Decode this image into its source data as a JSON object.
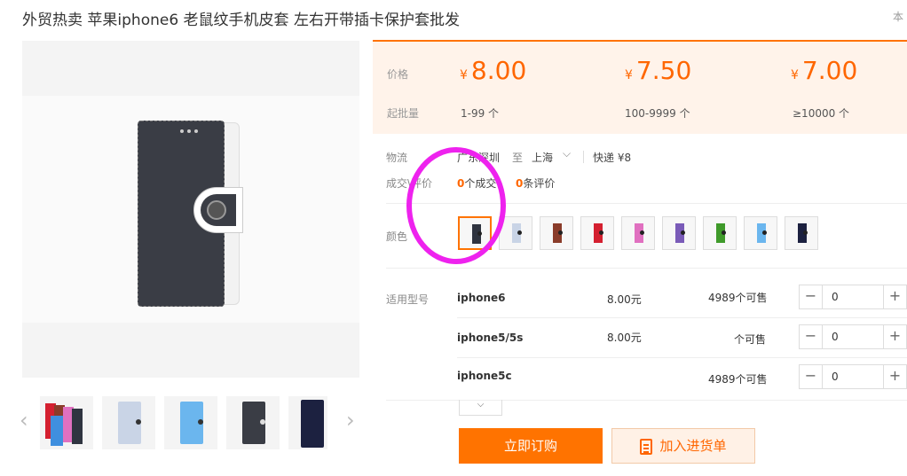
{
  "title": "外贸热卖 苹果iphone6 老鼠纹手机皮套 左右开带插卡保护套批发",
  "title_right": "本",
  "gallery": {
    "prev_icon": "‹",
    "next_icon": "›"
  },
  "price_section": {
    "price_label": "价格",
    "moq_label": "起批量",
    "currency": "¥",
    "tiers": [
      {
        "price": "8.00",
        "range": "1-99 个"
      },
      {
        "price": "7.50",
        "range": "100-9999 个"
      },
      {
        "price": "7.00",
        "range": "≥10000 个"
      }
    ]
  },
  "logistics": {
    "label": "物流",
    "from": "广东深圳",
    "to_word": "至",
    "to": "上海",
    "shipping": "快递 ¥8"
  },
  "deals": {
    "label": "成交\\评价",
    "deal_count": "0",
    "deal_suffix": "个成交",
    "review_count": "0",
    "review_suffix": "条评价"
  },
  "color": {
    "label": "颜色",
    "swatch_colors": [
      "#2f3440",
      "#c9d4e6",
      "#8a3c2a",
      "#d42030",
      "#e070c0",
      "#7a5bb8",
      "#3f9a2a",
      "#6bb6ee",
      "#1c2140"
    ]
  },
  "models": {
    "label": "适用型号",
    "stock_suffix": "个可售",
    "rows": [
      {
        "name": "iphone6",
        "price": "8.00元",
        "stock": "4989",
        "qty": "0"
      },
      {
        "name": "iphone5/5s",
        "price": "8.00元",
        "stock": "",
        "qty": "0"
      },
      {
        "name": "iphone5c",
        "price": "",
        "stock": "4989",
        "qty": "0"
      }
    ]
  },
  "actions": {
    "buy": "立即订购",
    "cart": "加入进货单"
  }
}
